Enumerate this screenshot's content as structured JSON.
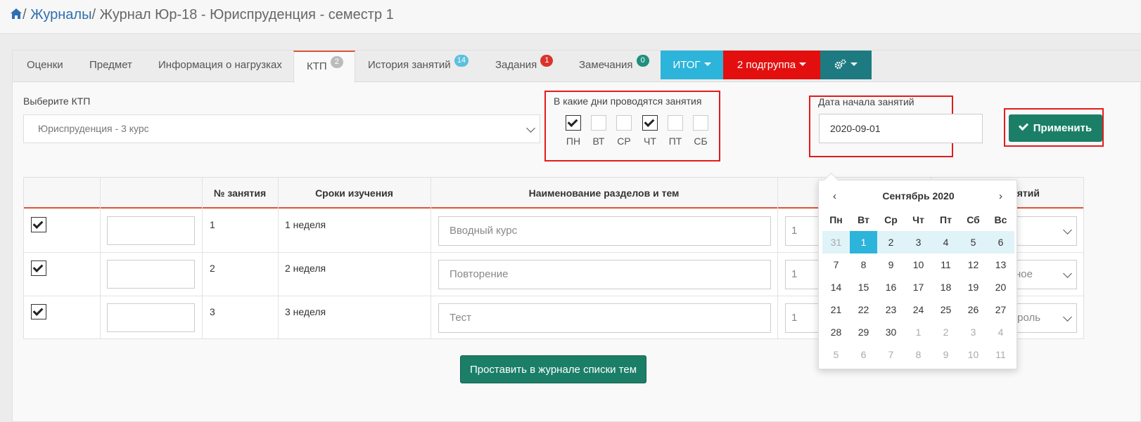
{
  "breadcrumb": {
    "sep1": "/",
    "link": "Журналы",
    "sep2": "/",
    "current": "Журнал Юр-18 - Юриспруденция - семестр 1"
  },
  "tabs": [
    {
      "label": "Оценки"
    },
    {
      "label": "Предмет"
    },
    {
      "label": "Информация о нагрузках"
    },
    {
      "label": "КТП",
      "badge": "2",
      "active": true
    },
    {
      "label": "История занятий",
      "badge": "14"
    },
    {
      "label": "Задания",
      "badge": "1"
    },
    {
      "label": "Замечания",
      "badge": "0"
    }
  ],
  "tab_buttons": {
    "itog": "ИТОГ",
    "subgroup": "2 подгруппа"
  },
  "colors": {
    "accent": "#e0533b",
    "primary": "#1b7f68",
    "cyan": "#2db4da",
    "red": "#e31b1b"
  },
  "ktp": {
    "label": "Выберите КТП",
    "selected": "Юриспруденция - 3 курс"
  },
  "days": {
    "label": "В какие дни проводятся занятия",
    "items": [
      {
        "label": "ПН",
        "checked": true
      },
      {
        "label": "ВТ",
        "checked": false
      },
      {
        "label": "СР",
        "checked": false
      },
      {
        "label": "ЧТ",
        "checked": true
      },
      {
        "label": "ПТ",
        "checked": false
      },
      {
        "label": "СБ",
        "checked": false
      }
    ]
  },
  "start_date": {
    "label": "Дата начала занятий",
    "value": "2020-09-01"
  },
  "apply_label": "Применить",
  "table": {
    "headers": [
      "",
      "",
      "№ занятия",
      "Сроки изучения",
      "Наименование разделов и тем",
      "",
      "ятий"
    ],
    "rows": [
      {
        "num": "1",
        "term": "1 неделя",
        "topic": "Вводный курс",
        "hours": "1",
        "type": ""
      },
      {
        "num": "2",
        "term": "2 неделя",
        "topic": "Повторение",
        "hours": "1",
        "type": "ное"
      },
      {
        "num": "3",
        "term": "3 неделя",
        "topic": "Тест",
        "hours": "1",
        "type": "нтроль"
      }
    ]
  },
  "bottom_button": "Проставить в журнале списки тем",
  "calendar": {
    "prev": "‹",
    "next": "›",
    "title": "Сентябрь 2020",
    "weekdays": [
      "Пн",
      "Вт",
      "Ср",
      "Чт",
      "Пт",
      "Сб",
      "Вс"
    ],
    "weeks": [
      [
        "31",
        "1",
        "2",
        "3",
        "4",
        "5",
        "6"
      ],
      [
        "7",
        "8",
        "9",
        "10",
        "11",
        "12",
        "13"
      ],
      [
        "14",
        "15",
        "16",
        "17",
        "18",
        "19",
        "20"
      ],
      [
        "21",
        "22",
        "23",
        "24",
        "25",
        "26",
        "27"
      ],
      [
        "28",
        "29",
        "30",
        "1",
        "2",
        "3",
        "4"
      ],
      [
        "5",
        "6",
        "7",
        "8",
        "9",
        "10",
        "11"
      ]
    ],
    "selected": "1"
  }
}
